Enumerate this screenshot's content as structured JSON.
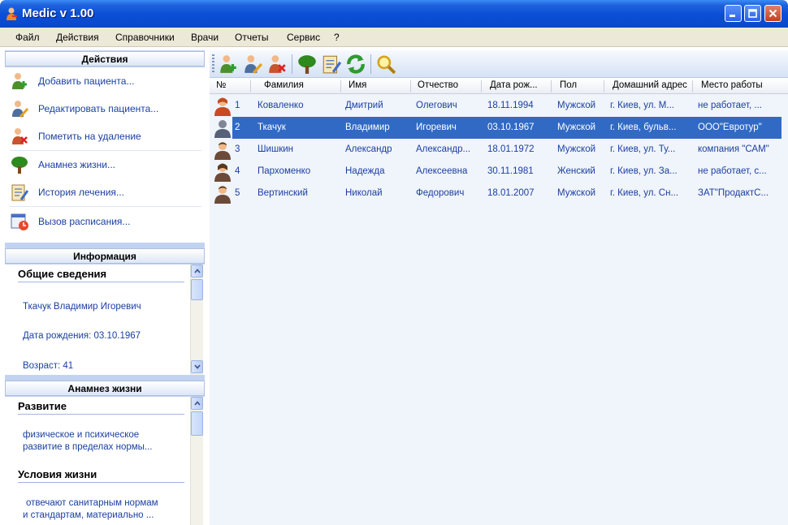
{
  "window": {
    "title": "Medic v 1.00"
  },
  "menu": [
    "Файл",
    "Действия",
    "Справочники",
    "Врачи",
    "Отчеты",
    "Сервис",
    "?"
  ],
  "actions_panel": {
    "header": "Действия",
    "items": [
      {
        "label": "Добавить пациента...",
        "icon": "add-patient-icon"
      },
      {
        "label": "Редактировать пациента...",
        "icon": "edit-patient-icon"
      },
      {
        "label": "Пометить на удаление",
        "icon": "delete-patient-icon"
      },
      {
        "label": "Анамнез жизни...",
        "icon": "tree-icon"
      },
      {
        "label": "История лечения...",
        "icon": "history-icon"
      },
      {
        "label": "Вызов расписания...",
        "icon": "schedule-icon"
      }
    ]
  },
  "info_panel": {
    "header": "Информация",
    "section_title": "Общие сведения",
    "name": "Ткачук Владимир Игоревич",
    "birth": "Дата рождения: 03.10.1967",
    "age": "Возраст: 41"
  },
  "anamnesis_panel": {
    "header": "Анамнез жизни",
    "development_title": "Развитие",
    "development_text_1": "физическое и психическое",
    "development_text_2": "развитие в пределах нормы...",
    "living_title": "Условия жизни",
    "living_text_1": "отвечают санитарным нормам",
    "living_text_2": "и стандартам, материально ..."
  },
  "grid": {
    "columns": [
      "№",
      "Фамилия",
      "Имя",
      "Отчество",
      "Дата рож...",
      "Пол",
      "Домашний адрес",
      "Место работы"
    ],
    "rows": [
      {
        "num": "1",
        "last": "Коваленко",
        "first": "Дмитрий",
        "middle": "Олегович",
        "birth": "18.11.1994",
        "sex": "Мужской",
        "address": "г. Киев, ул. М...",
        "work": "не работает, ..."
      },
      {
        "num": "2",
        "last": "Ткачук",
        "first": "Владимир",
        "middle": "Игоревич",
        "birth": "03.10.1967",
        "sex": "Мужской",
        "address": "г. Киев, бульв...",
        "work": "ООО\"Евротур\""
      },
      {
        "num": "3",
        "last": "Шишкин",
        "first": "Александр",
        "middle": "Александр...",
        "birth": "18.01.1972",
        "sex": "Мужской",
        "address": "г. Киев, ул. Ту...",
        "work": "компания \"САМ\""
      },
      {
        "num": "4",
        "last": "Пархоменко",
        "first": "Надежда",
        "middle": "Алексеевна",
        "birth": "30.11.1981",
        "sex": "Женский",
        "address": "г. Киев, ул. За...",
        "work": "не работает, с..."
      },
      {
        "num": "5",
        "last": "Вертинский",
        "first": "Николай",
        "middle": "Федорович",
        "birth": "18.01.2007",
        "sex": "Мужской",
        "address": "г. Киев, ул. Сн...",
        "work": "ЗАТ\"ПродактС..."
      }
    ],
    "selected_row": 2
  },
  "colors": {
    "titlebar": "#0b4fd6",
    "selection": "#316ac5",
    "link_text": "#1a3fa0",
    "panel_bg": "#c2d3f2"
  }
}
